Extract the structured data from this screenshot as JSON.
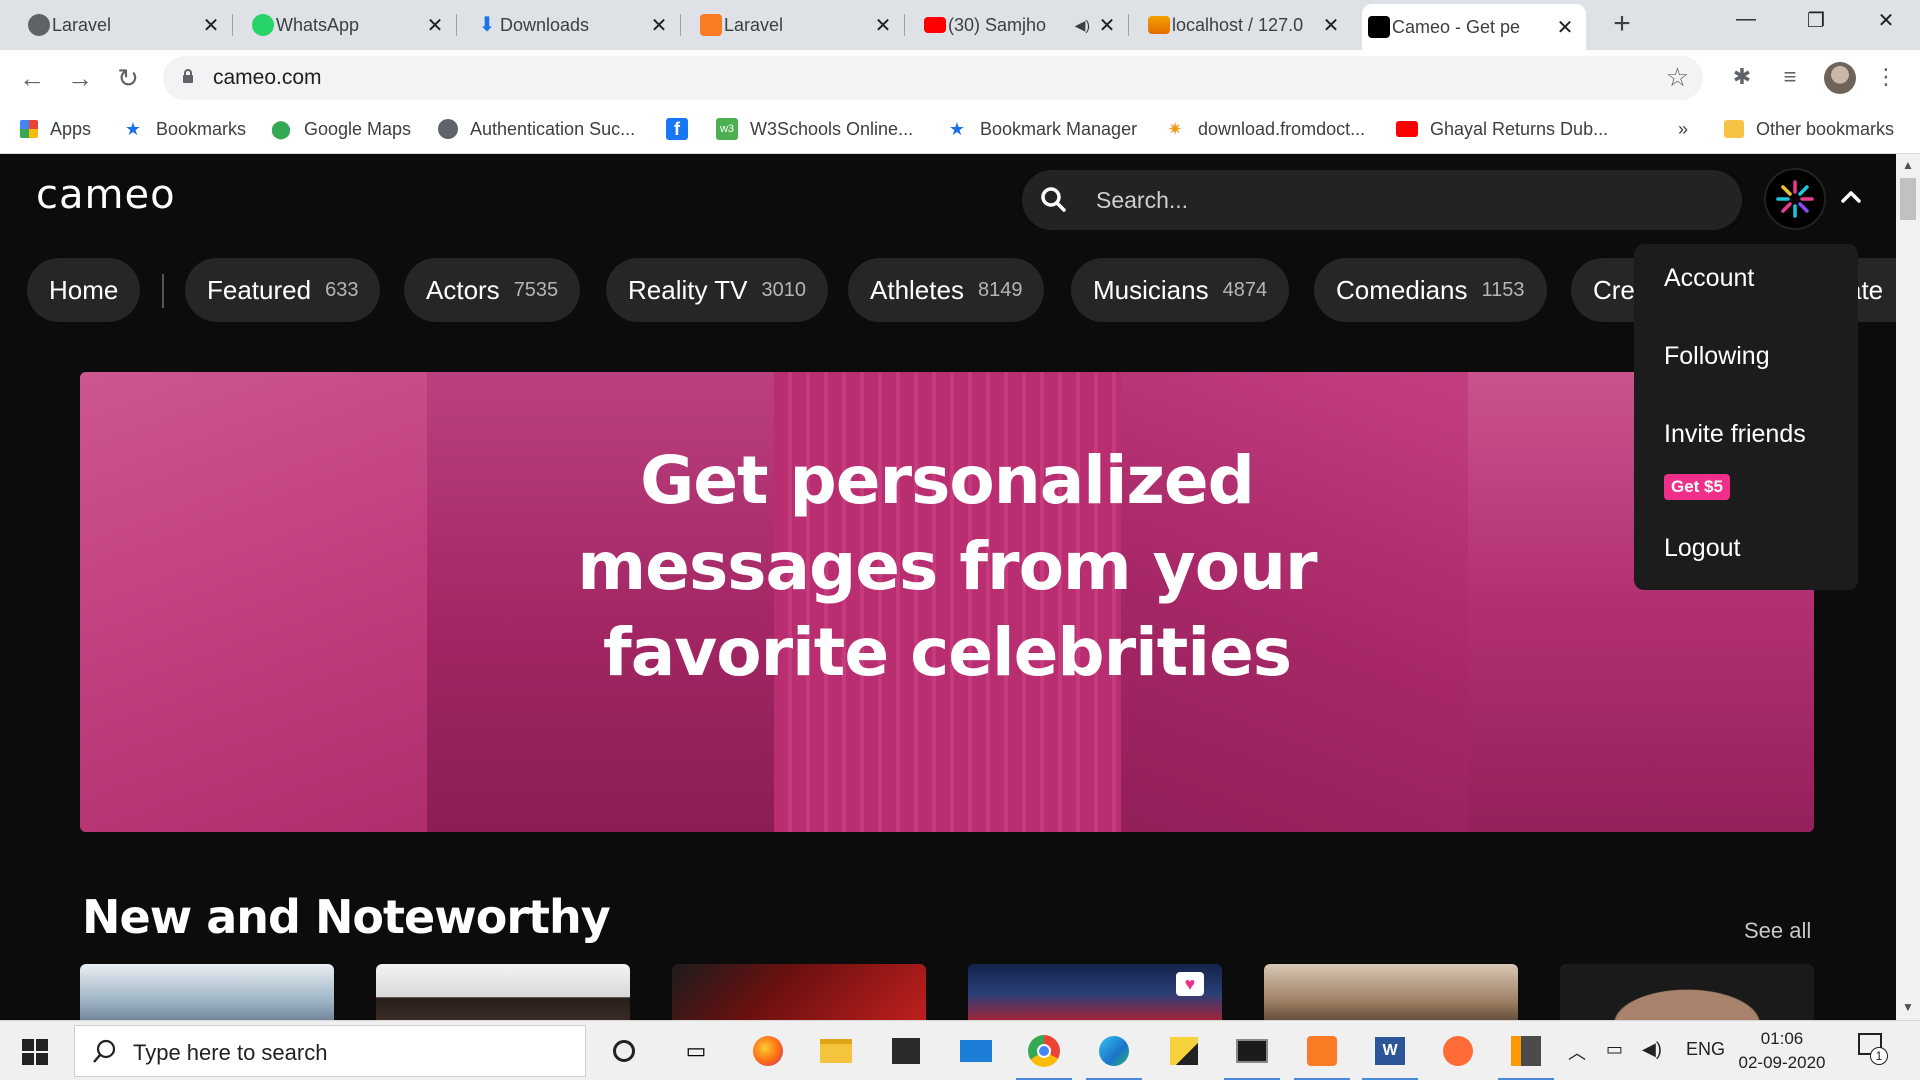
{
  "browser": {
    "tabs": [
      {
        "title": "Laravel",
        "icon": "globe-icon"
      },
      {
        "title": "WhatsApp",
        "icon": "whatsapp-icon"
      },
      {
        "title": "Downloads",
        "icon": "download-icon"
      },
      {
        "title": "Laravel",
        "icon": "xampp-icon"
      },
      {
        "title": "(30) Samjho",
        "icon": "youtube-icon"
      },
      {
        "title": "localhost / 127.0",
        "icon": "phpmyadmin-icon"
      },
      {
        "title": "Cameo - Get pe",
        "icon": "cameo-icon",
        "active": true
      }
    ],
    "url": "cameo.com",
    "bookmarks": [
      {
        "label": "Apps",
        "icon": "apps-grid-icon"
      },
      {
        "label": "Bookmarks",
        "icon": "star-icon"
      },
      {
        "label": "Google Maps",
        "icon": "maps-pin-icon"
      },
      {
        "label": "Authentication Suc...",
        "icon": "globe-icon"
      },
      {
        "label": "",
        "icon": "facebook-icon"
      },
      {
        "label": "W3Schools Online...",
        "icon": "w3schools-icon"
      },
      {
        "label": "Bookmark Manager",
        "icon": "star-icon"
      },
      {
        "label": "download.fromdoct...",
        "icon": "sun-icon"
      },
      {
        "label": "Ghayal Returns Dub...",
        "icon": "youtube-icon"
      }
    ],
    "bookmarks_overflow": "»",
    "other_bookmarks": "Other bookmarks"
  },
  "site": {
    "logo": "cameo",
    "search_placeholder": "Search...",
    "categories": [
      {
        "label": "Home",
        "count": ""
      },
      {
        "label": "Featured",
        "count": "633"
      },
      {
        "label": "Actors",
        "count": "7535"
      },
      {
        "label": "Reality TV",
        "count": "3010"
      },
      {
        "label": "Athletes",
        "count": "8149"
      },
      {
        "label": "Musicians",
        "count": "4874"
      },
      {
        "label": "Comedians",
        "count": "1153"
      },
      {
        "label": "Cre",
        "count": ""
      }
    ],
    "hidden_pill_fragment": "cate",
    "hero": {
      "line1": "Get personalized",
      "line2": "messages from your",
      "line3": "favorite celebrities"
    },
    "section": {
      "title": "New and Noteworthy",
      "see_all": "See all"
    },
    "menu": {
      "account": "Account",
      "following": "Following",
      "invite": "Invite friends",
      "invite_badge": "Get $5",
      "logout": "Logout"
    },
    "colors": {
      "accent": "#f02f8a",
      "hero": "#b0306e"
    }
  },
  "taskbar": {
    "search_placeholder": "Type here to search",
    "language": "ENG",
    "time": "01:06",
    "date": "02-09-2020",
    "notification_count": "1"
  }
}
